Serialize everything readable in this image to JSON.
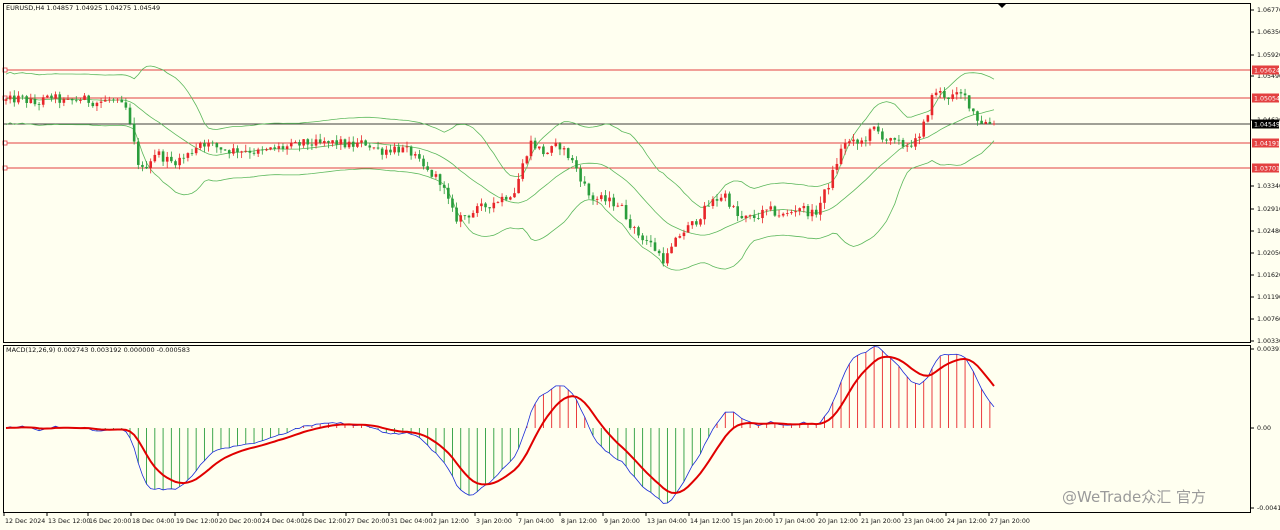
{
  "window": {
    "symbol_header": "EURUSD,H4  1.04857 1.04925 1.04275 1.04549",
    "watermark": "@WeTrade众汇 官方"
  },
  "colors": {
    "background": "#fffff0",
    "up_candle": "#e8262a",
    "down_candle": "#2a9d3c",
    "bollinger": "#5cb85c",
    "macd_line": "#e00000",
    "signal_line": "#1a2bd8",
    "level_line": "#e34040",
    "price_line": "#000000"
  },
  "price_axis": {
    "ticks": [
      "1.06770",
      "1.06350",
      "1.05920",
      "1.05490",
      "1.04620",
      "1.03340",
      "1.02910",
      "1.02480",
      "1.02050",
      "1.01620",
      "1.01190",
      "1.00760",
      "1.00330"
    ],
    "levels": [
      {
        "label": "1.05624",
        "kind": "level"
      },
      {
        "label": "1.05054",
        "kind": "level"
      },
      {
        "label": "1.04549",
        "kind": "current"
      },
      {
        "label": "1.04191",
        "kind": "level"
      },
      {
        "label": "1.03701",
        "kind": "level"
      }
    ]
  },
  "macd": {
    "header": "MACD(12,26,9) 0.002743 0.003192 0.000000 -0.000583",
    "ticks": [
      "0.003914",
      "0.00",
      "-0.00412"
    ]
  },
  "time_axis": [
    "12 Dec 2024",
    "13 Dec 12:00",
    "16 Dec 20:00",
    "18 Dec 04:00",
    "19 Dec 12:00",
    "20 Dec 20:00",
    "24 Dec 04:00",
    "26 Dec 12:00",
    "27 Dec 20:00",
    "31 Dec 04:00",
    "2 Jan 12:00",
    "3 Jan 20:00",
    "7 Jan 04:00",
    "8 Jan 12:00",
    "9 Jan 20:00",
    "13 Jan 04:00",
    "14 Jan 12:00",
    "15 Jan 20:00",
    "17 Jan 04:00",
    "20 Jan 12:00",
    "21 Jan 20:00",
    "23 Jan 04:00",
    "24 Jan 12:00",
    "27 Jan 20:00"
  ],
  "chart_data": {
    "type": "candlestick",
    "timeframe": "H4",
    "path_prices": [
      1.05,
      1.0505,
      1.0493,
      1.0508,
      1.0496,
      1.0504,
      1.0497,
      1.0502,
      1.0485,
      1.036,
      1.04,
      1.038,
      1.039,
      1.042,
      1.041,
      1.0403,
      1.0405,
      1.0398,
      1.0407,
      1.041,
      1.0417,
      1.0415,
      1.0419,
      1.0412,
      1.0418,
      1.0402,
      1.0408,
      1.04,
      1.0365,
      1.0345,
      1.0272,
      1.0282,
      1.0296,
      1.031,
      1.0325,
      1.042,
      1.0397,
      1.0413,
      1.0375,
      1.0313,
      1.0307,
      1.03,
      1.0247,
      1.0225,
      1.019,
      1.024,
      1.0265,
      1.03,
      1.032,
      1.027,
      1.0275,
      1.0288,
      1.0277,
      1.0296,
      1.0278,
      1.034,
      1.042,
      1.0415,
      1.0445,
      1.042,
      1.0413,
      1.0422,
      1.052,
      1.0508,
      1.0511,
      1.046,
      1.0455
    ]
  }
}
